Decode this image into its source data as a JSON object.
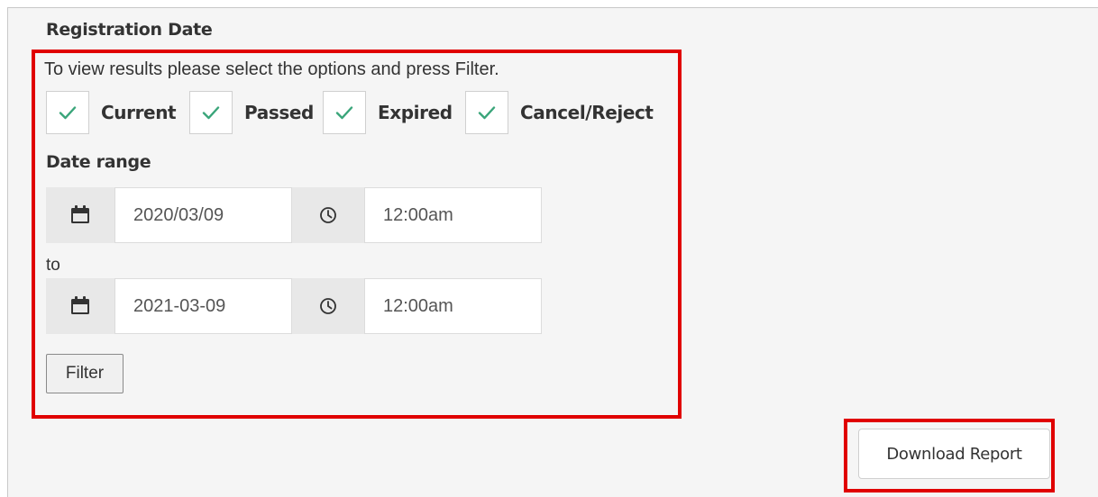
{
  "section": {
    "title": "Registration Date"
  },
  "form": {
    "instructions": "To view results please select the options and press Filter.",
    "checkboxes": [
      {
        "label": "Current",
        "checked": true
      },
      {
        "label": "Passed",
        "checked": true
      },
      {
        "label": "Expired",
        "checked": true
      },
      {
        "label": "Cancel/Reject",
        "checked": true
      }
    ],
    "date_range_label": "Date range",
    "from": {
      "date": "2020/03/09",
      "time": "12:00am"
    },
    "to_label": "to",
    "to": {
      "date": "2021-03-09",
      "time": "12:00am"
    },
    "filter_label": "Filter"
  },
  "actions": {
    "download_label": "Download Report"
  },
  "icons": {
    "calendar": "calendar-icon",
    "clock": "clock-icon",
    "check": "check-icon"
  },
  "colors": {
    "highlight": "#e00000",
    "check": "#3aa57a",
    "panel_bg": "#f5f5f5"
  }
}
